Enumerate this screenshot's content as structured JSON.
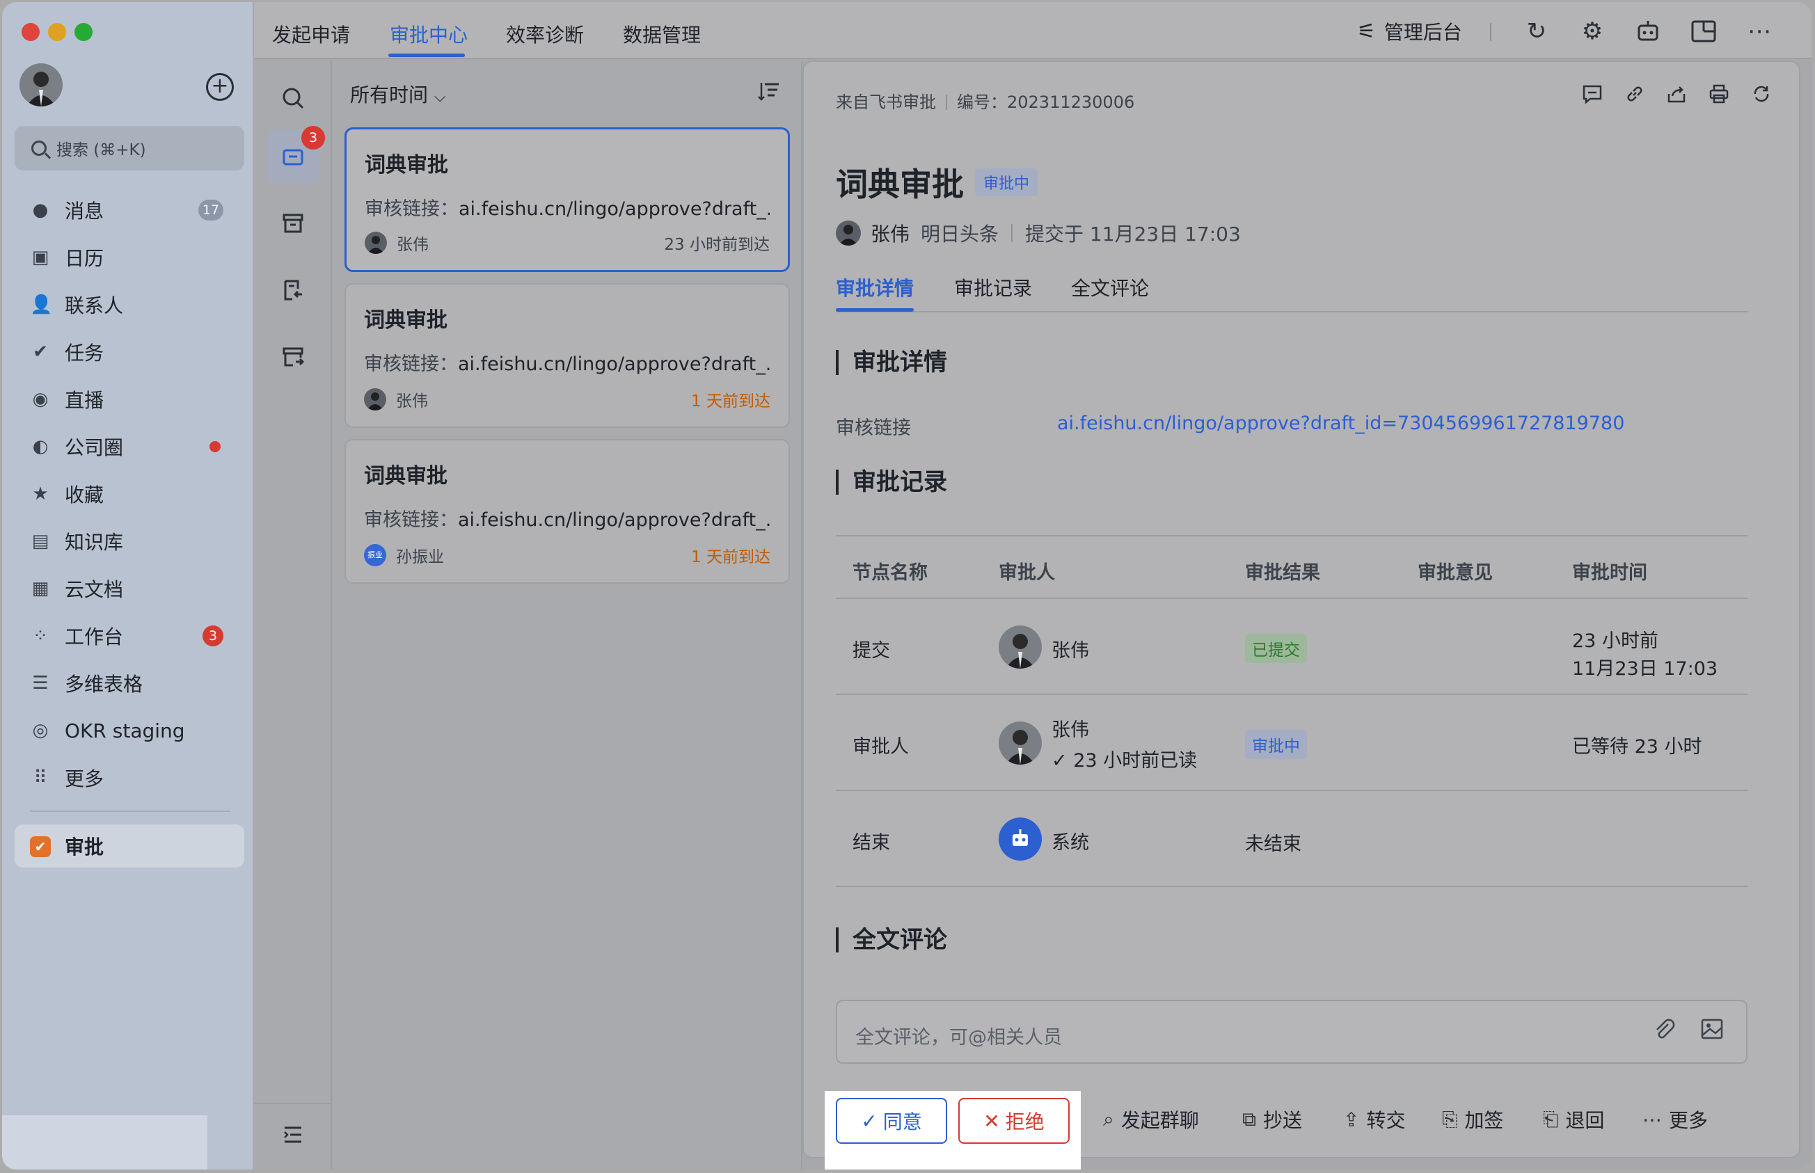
{
  "colors": {
    "accent": "#2c5fcf",
    "danger": "#d83931",
    "warning": "#c15b00",
    "success": "#2c7a2c"
  },
  "sidebar": {
    "search_placeholder": "搜索 (⌘+K)",
    "items": [
      {
        "label": "消息",
        "icon": "chat-bubble-icon",
        "badge": "17"
      },
      {
        "label": "日历",
        "icon": "calendar-icon"
      },
      {
        "label": "联系人",
        "icon": "contacts-icon"
      },
      {
        "label": "任务",
        "icon": "task-check-icon"
      },
      {
        "label": "直播",
        "icon": "live-icon"
      },
      {
        "label": "公司圈",
        "icon": "moments-icon",
        "dot": true
      },
      {
        "label": "收藏",
        "icon": "star-icon"
      },
      {
        "label": "知识库",
        "icon": "wiki-icon"
      },
      {
        "label": "云文档",
        "icon": "docs-icon"
      },
      {
        "label": "工作台",
        "icon": "apps-grid-icon",
        "badge": "3"
      },
      {
        "label": "多维表格",
        "icon": "base-table-icon"
      },
      {
        "label": "OKR staging",
        "icon": "okr-icon"
      },
      {
        "label": "更多",
        "icon": "more-dots-grid-icon"
      }
    ],
    "active_app": {
      "label": "审批",
      "icon": "approval-app-icon"
    }
  },
  "topbar": {
    "tabs": [
      "发起申请",
      "审批中心",
      "效率诊断",
      "数据管理"
    ],
    "active_tab": "审批中心",
    "admin_label": "管理后台"
  },
  "rail": {
    "badge": "3"
  },
  "list": {
    "filter_label": "所有时间",
    "cards": [
      {
        "title": "词典审批",
        "link_label": "审核链接：",
        "link": "ai.feishu.cn/lingo/approve?draft_...",
        "user": "张伟",
        "time": "23 小时前到达",
        "overdue": false
      },
      {
        "title": "词典审批",
        "link_label": "审核链接：",
        "link": "ai.feishu.cn/lingo/approve?draft_...",
        "user": "张伟",
        "time": "1 天前到达",
        "overdue": true
      },
      {
        "title": "词典审批",
        "link_label": "审核链接：",
        "link": "ai.feishu.cn/lingo/approve?draft_...",
        "user": "孙振业",
        "avatar_text": "振业",
        "time": "1 天前到达",
        "overdue": true
      }
    ]
  },
  "detail": {
    "source": "来自飞书审批",
    "number_label": "编号：",
    "number": "202311230006",
    "title": "词典审批",
    "status": "审批中",
    "submitter": "张伟",
    "dept": "明日头条",
    "submitted": "提交于 11月23日 17:03",
    "tabs": [
      "审批详情",
      "审批记录",
      "全文评论"
    ],
    "section_detail": "审批详情",
    "field_label": "审核链接",
    "field_value": "ai.feishu.cn/lingo/approve?draft_id=7304569961727819780",
    "section_records": "审批记录",
    "table": {
      "headers": [
        "节点名称",
        "审批人",
        "审批结果",
        "审批意见",
        "审批时间"
      ],
      "rows": [
        {
          "node": "提交",
          "user": "张伟",
          "result": "已提交",
          "time1": "23 小时前",
          "time2": "11月23日 17:03"
        },
        {
          "node": "审批人",
          "user": "张伟",
          "sub": "23 小时前已读",
          "result": "审批中",
          "time1": "已等待 23 小时"
        },
        {
          "node": "结束",
          "user": "系统",
          "result": "未结束"
        }
      ]
    },
    "section_comments": "全文评论",
    "comment_placeholder": "全文评论，可@相关人员"
  },
  "actions": {
    "agree": "同意",
    "reject": "拒绝",
    "others": [
      {
        "label": "发起群聊",
        "icon": "group-chat-icon"
      },
      {
        "label": "抄送",
        "icon": "cc-icon"
      },
      {
        "label": "转交",
        "icon": "transfer-icon"
      },
      {
        "label": "加签",
        "icon": "add-sign-icon"
      },
      {
        "label": "退回",
        "icon": "return-icon"
      },
      {
        "label": "更多",
        "icon": "more-horizontal-icon"
      }
    ]
  }
}
